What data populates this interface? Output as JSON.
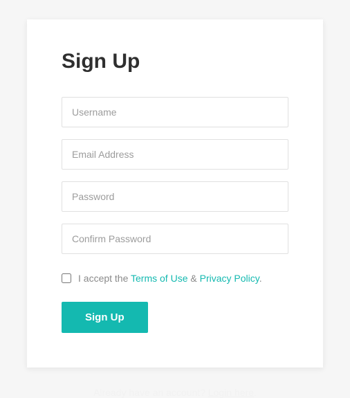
{
  "card": {
    "title": "Sign Up",
    "fields": {
      "username": {
        "placeholder": "Username",
        "value": ""
      },
      "email": {
        "placeholder": "Email Address",
        "value": ""
      },
      "password": {
        "placeholder": "Password",
        "value": ""
      },
      "confirm": {
        "placeholder": "Confirm Password",
        "value": ""
      }
    },
    "terms": {
      "checked": false,
      "pre": "I accept the ",
      "tos": "Terms of Use",
      "mid": " & ",
      "pp": "Privacy Policy",
      "post": "."
    },
    "submit_label": "Sign Up"
  },
  "footer": {
    "text": "Already have an account? ",
    "link": "Login here",
    "post": "."
  },
  "colors": {
    "accent": "#14b9b0"
  }
}
